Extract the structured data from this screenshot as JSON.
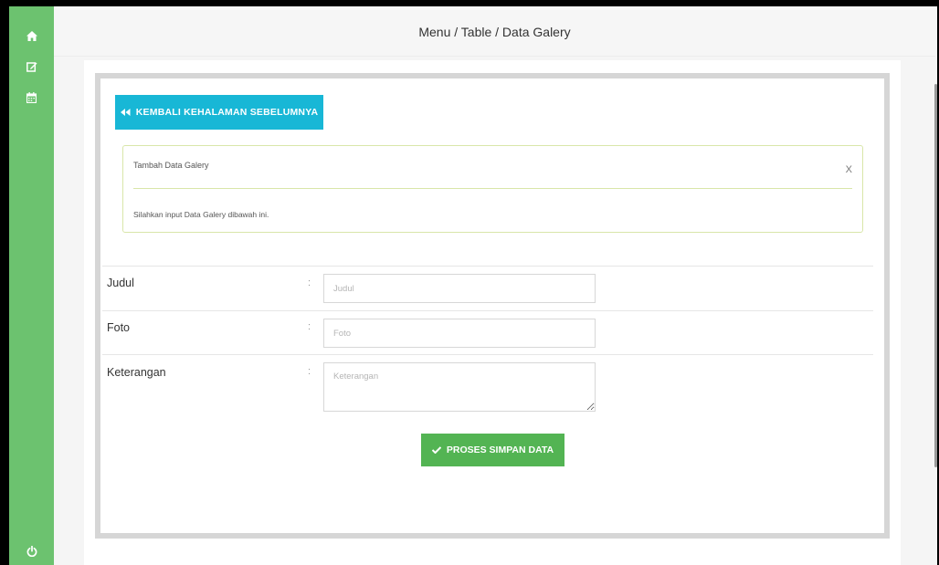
{
  "sidebar": {
    "items": [
      {
        "name": "home",
        "icon": "home-icon"
      },
      {
        "name": "edit",
        "icon": "edit-icon"
      },
      {
        "name": "calendar",
        "icon": "calendar-icon"
      }
    ],
    "bottom": {
      "icon": "power-icon"
    },
    "color": "#6cc26f"
  },
  "header": {
    "breadcrumb": "Menu / Table / Data Galery"
  },
  "buttons": {
    "back_label": "KEMBALI KEHALAMAN SEBELUMNYA",
    "back_icon": "double-left-arrow-icon",
    "back_color": "#18b7d6",
    "save_label": "PROSES SIMPAN DATA",
    "save_icon": "check-icon",
    "save_color": "#53b453"
  },
  "alert": {
    "title": "Tambah Data Galery",
    "close": "X",
    "message": "Silahkan input Data Galery dibawah ini."
  },
  "form": {
    "separator": ":",
    "fields": [
      {
        "label": "Judul",
        "placeholder": "Judul",
        "value": ""
      },
      {
        "label": "Foto",
        "placeholder": "Foto",
        "value": ""
      },
      {
        "label": "Keterangan",
        "placeholder": "Keterangan",
        "value": ""
      }
    ]
  }
}
